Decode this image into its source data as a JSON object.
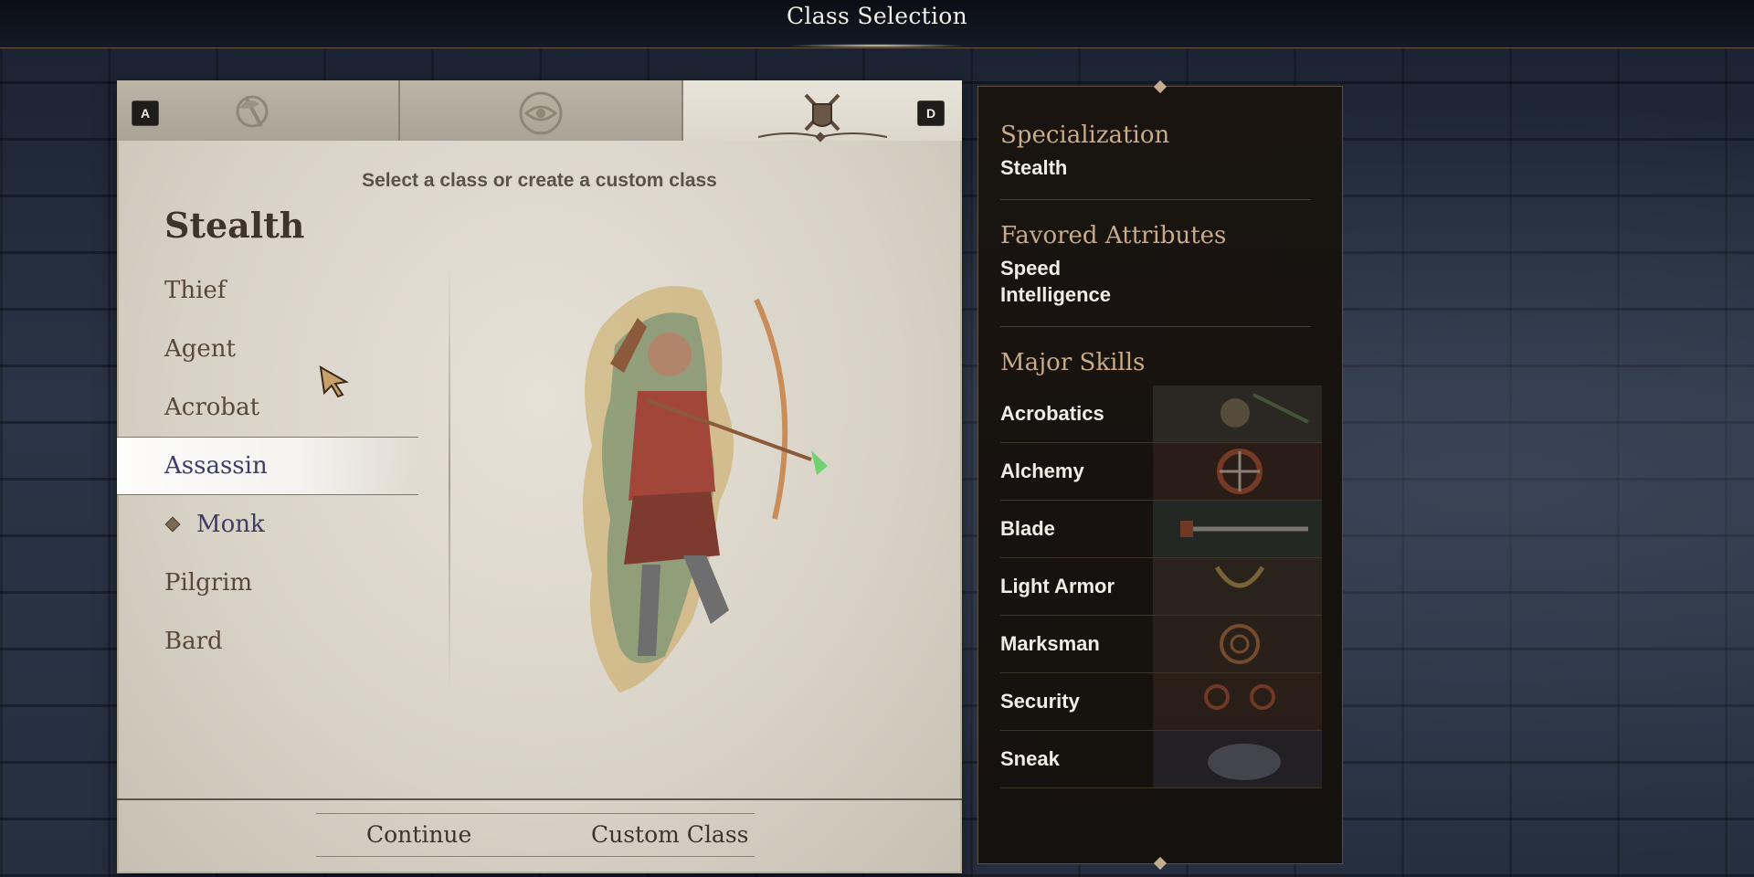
{
  "header": {
    "title": "Class Selection"
  },
  "tabs": [
    {
      "key": "A",
      "icon": "axe-emblem-icon"
    },
    {
      "icon": "eye-emblem-icon"
    },
    {
      "key": "D",
      "icon": "crossed-blades-emblem-icon",
      "active": true
    }
  ],
  "panel": {
    "subtitle": "Select a class or create a custom class",
    "group": "Stealth",
    "classes": [
      "Thief",
      "Agent",
      "Acrobat",
      "Assassin",
      "Monk",
      "Pilgrim",
      "Bard"
    ],
    "selected": "Assassin",
    "marked": "Monk"
  },
  "buttons": {
    "continue": "Continue",
    "custom": "Custom Class"
  },
  "info": {
    "specialization_title": "Specialization",
    "specialization": "Stealth",
    "attributes_title": "Favored Attributes",
    "attributes": [
      "Speed",
      "Intelligence"
    ],
    "skills_title": "Major Skills",
    "skills": [
      "Acrobatics",
      "Alchemy",
      "Blade",
      "Light Armor",
      "Marksman",
      "Security",
      "Sneak"
    ]
  },
  "colors": {
    "accent_title": "#c9ab89",
    "selected_text": "#3e3c68",
    "parchment": "#ddd7cc"
  }
}
